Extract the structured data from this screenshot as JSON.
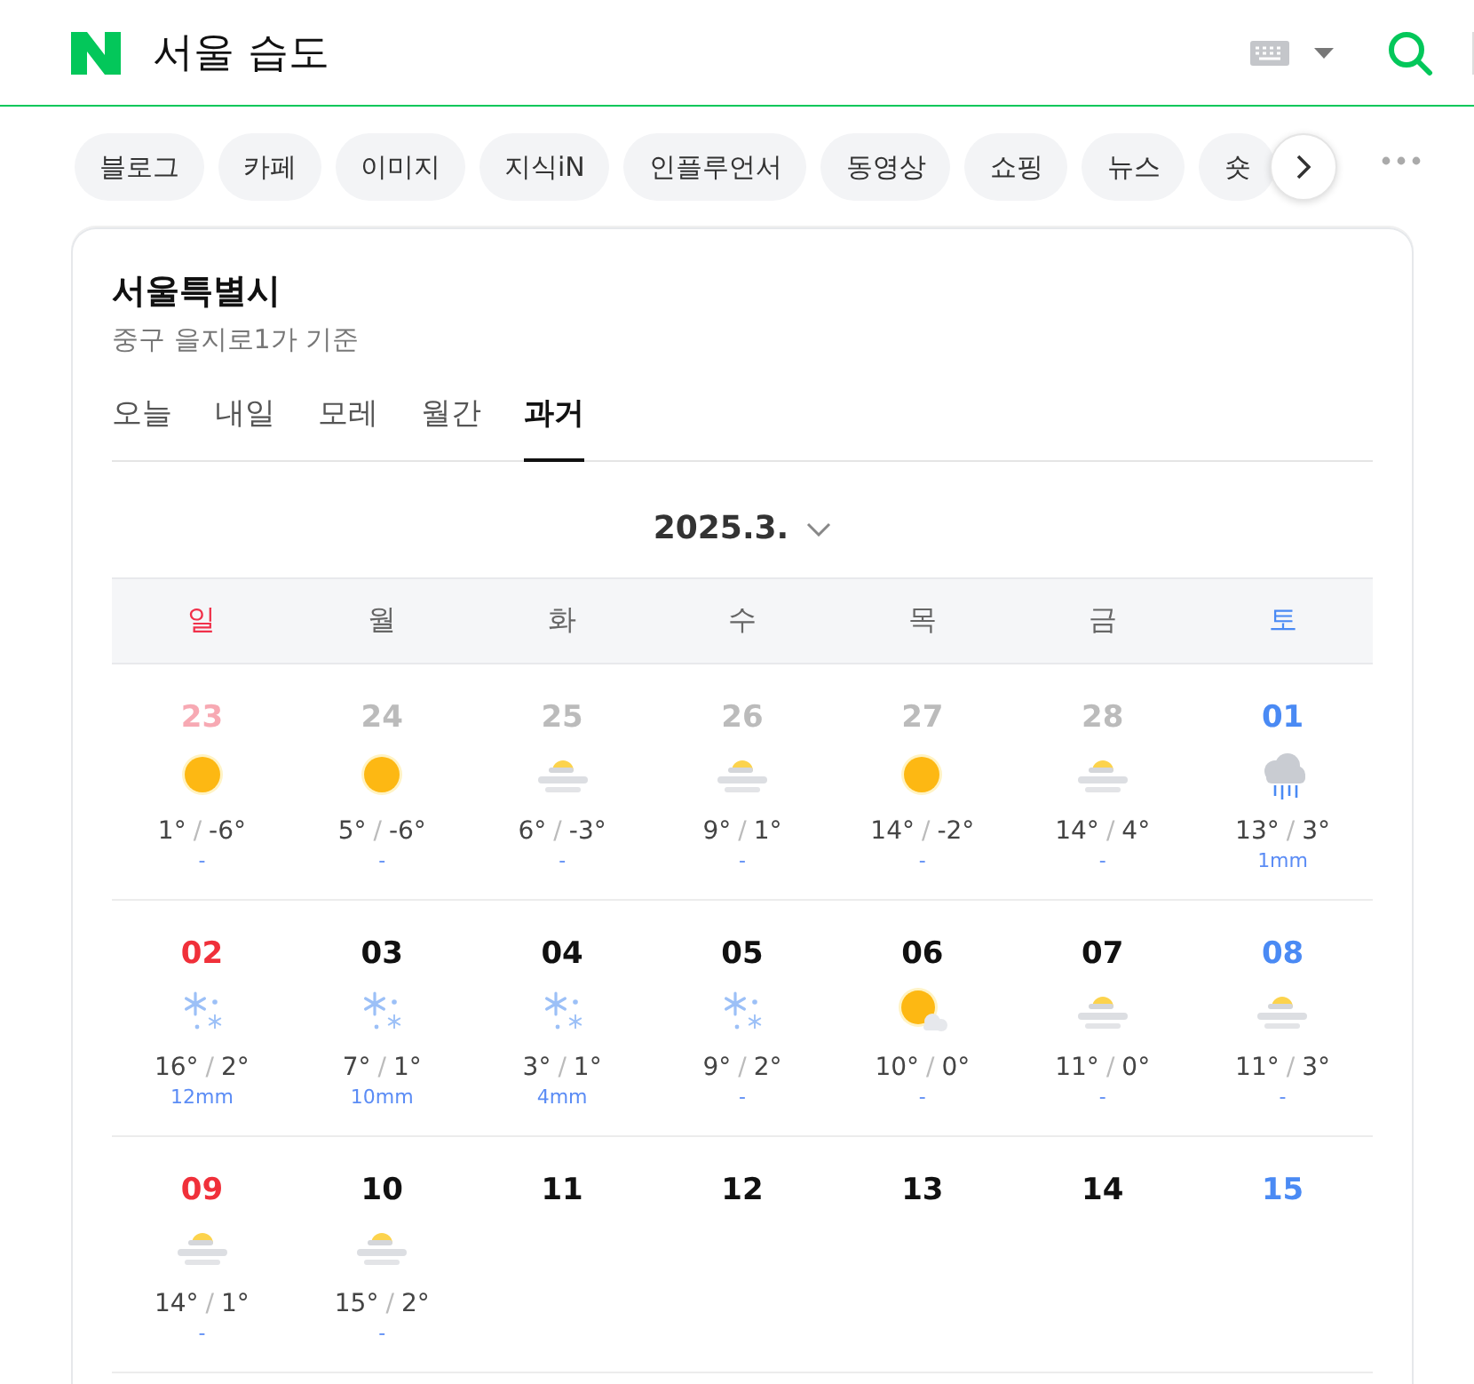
{
  "header": {
    "query": "서울 습도"
  },
  "chips": [
    {
      "label": "블로그"
    },
    {
      "label": "카페"
    },
    {
      "label": "이미지"
    },
    {
      "label": "지식iN"
    },
    {
      "label": "인플루언서"
    },
    {
      "label": "동영상"
    },
    {
      "label": "쇼핑"
    },
    {
      "label": "뉴스"
    },
    {
      "label": "숏"
    }
  ],
  "weather": {
    "city": "서울특별시",
    "location": "중구 을지로1가 기준",
    "tabs": [
      {
        "label": "오늘",
        "selected": false
      },
      {
        "label": "내일",
        "selected": false
      },
      {
        "label": "모레",
        "selected": false
      },
      {
        "label": "월간",
        "selected": false
      },
      {
        "label": "과거",
        "selected": true
      }
    ],
    "month": "2025.3.",
    "weekdays": [
      {
        "label": "일",
        "color": "#f0304a"
      },
      {
        "label": "월",
        "color": "#666666"
      },
      {
        "label": "화",
        "color": "#666666"
      },
      {
        "label": "수",
        "color": "#666666"
      },
      {
        "label": "목",
        "color": "#666666"
      },
      {
        "label": "금",
        "color": "#666666"
      },
      {
        "label": "토",
        "color": "#4a8af4"
      }
    ],
    "days": [
      {
        "day": "23",
        "other_month": true,
        "kind": "sun",
        "high": "1°",
        "separator": "/",
        "low": "-6°",
        "precip": "-"
      },
      {
        "day": "24",
        "other_month": true,
        "kind": "sun",
        "high": "5°",
        "separator": "/",
        "low": "-6°",
        "precip": "-"
      },
      {
        "day": "25",
        "other_month": true,
        "kind": "haze",
        "high": "6°",
        "separator": "/",
        "low": "-3°",
        "precip": "-"
      },
      {
        "day": "26",
        "other_month": true,
        "kind": "haze",
        "high": "9°",
        "separator": "/",
        "low": "1°",
        "precip": "-"
      },
      {
        "day": "27",
        "other_month": true,
        "kind": "sun",
        "high": "14°",
        "separator": "/",
        "low": "-2°",
        "precip": "-"
      },
      {
        "day": "28",
        "other_month": true,
        "kind": "haze",
        "high": "14°",
        "separator": "/",
        "low": "4°",
        "precip": "-"
      },
      {
        "day": "01",
        "other_month": false,
        "kind": "rain",
        "high": "13°",
        "separator": "/",
        "low": "3°",
        "precip": "1mm"
      },
      {
        "day": "02",
        "other_month": false,
        "kind": "snow",
        "high": "16°",
        "separator": "/",
        "low": "2°",
        "precip": "12mm"
      },
      {
        "day": "03",
        "other_month": false,
        "kind": "snow",
        "high": "7°",
        "separator": "/",
        "low": "1°",
        "precip": "10mm"
      },
      {
        "day": "04",
        "other_month": false,
        "kind": "snow",
        "high": "3°",
        "separator": "/",
        "low": "1°",
        "precip": "4mm"
      },
      {
        "day": "05",
        "other_month": false,
        "kind": "snow",
        "high": "9°",
        "separator": "/",
        "low": "2°",
        "precip": "-"
      },
      {
        "day": "06",
        "other_month": false,
        "kind": "partly",
        "high": "10°",
        "separator": "/",
        "low": "0°",
        "precip": "-"
      },
      {
        "day": "07",
        "other_month": false,
        "kind": "haze",
        "high": "11°",
        "separator": "/",
        "low": "0°",
        "precip": "-"
      },
      {
        "day": "08",
        "other_month": false,
        "kind": "haze",
        "high": "11°",
        "separator": "/",
        "low": "3°",
        "precip": "-"
      },
      {
        "day": "09",
        "other_month": false,
        "kind": "haze",
        "high": "14°",
        "separator": "/",
        "low": "1°",
        "precip": "-"
      },
      {
        "day": "10",
        "other_month": false,
        "kind": "haze",
        "high": "15°",
        "separator": "/",
        "low": "2°",
        "precip": "-"
      },
      {
        "day": "11",
        "other_month": false
      },
      {
        "day": "12",
        "other_month": false
      },
      {
        "day": "13",
        "other_month": false
      },
      {
        "day": "14",
        "other_month": false
      },
      {
        "day": "15",
        "other_month": false
      }
    ]
  }
}
